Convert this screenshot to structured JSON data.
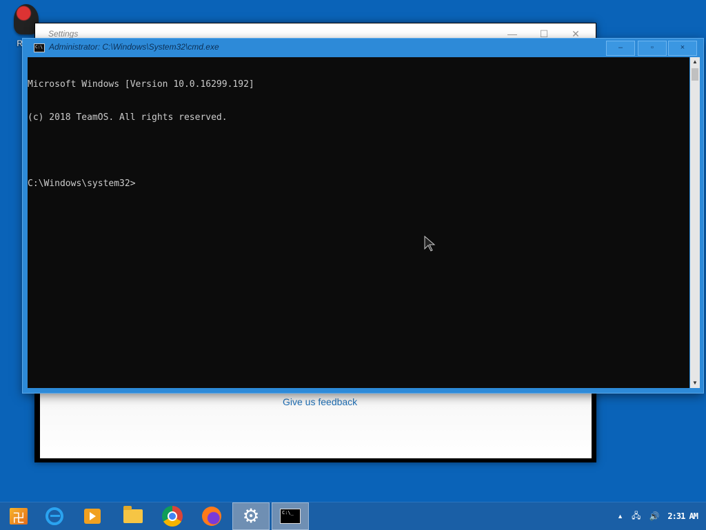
{
  "desktop": {
    "icons": [
      {
        "label": "Recy",
        "icon": "recycle-bin-icon"
      }
    ]
  },
  "settings_window": {
    "title": "Settings",
    "minimize": "—",
    "maximize": "☐",
    "close": "✕",
    "feedback_link": "Give us feedback"
  },
  "cmd_window": {
    "title": "Administrator: C:\\Windows\\System32\\cmd.exe",
    "icon": "cmd-icon",
    "minimize": "–",
    "maximize": "▫",
    "close": "×",
    "console_lines": [
      "Microsoft Windows [Version 10.0.16299.192]",
      "(c) 2018 TeamOS. All rights reserved.",
      "",
      "C:\\Windows\\system32>"
    ]
  },
  "taskbar": {
    "items": [
      {
        "name": "start",
        "icon": "start-icon"
      },
      {
        "name": "internet-explorer",
        "icon": "internet-explorer-icon"
      },
      {
        "name": "media-player",
        "icon": "media-player-icon"
      },
      {
        "name": "file-explorer",
        "icon": "folder-icon"
      },
      {
        "name": "chrome",
        "icon": "chrome-icon"
      },
      {
        "name": "firefox",
        "icon": "firefox-icon"
      },
      {
        "name": "settings",
        "icon": "gear-icon"
      },
      {
        "name": "command-prompt",
        "icon": "cmd-icon"
      }
    ],
    "tray": {
      "chevron": "▲",
      "network": "🖧",
      "volume": "🔊",
      "clock": "2:31 AM"
    }
  }
}
